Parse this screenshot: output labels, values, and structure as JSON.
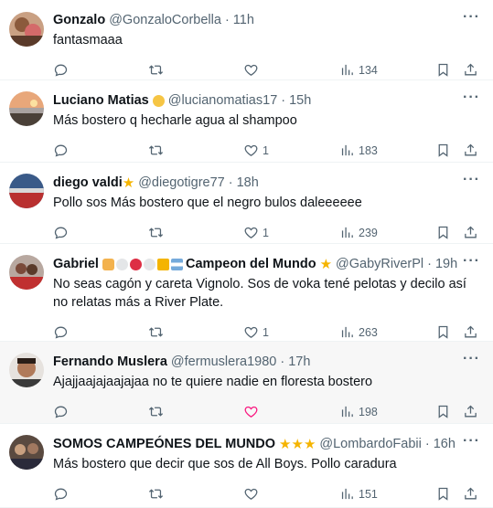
{
  "tweets": [
    {
      "name": "Gonzalo",
      "handle": "@GonzaloCorbella",
      "time": "11h",
      "text": "fantasmaaa",
      "likes": "",
      "views": "134"
    },
    {
      "name": "Luciano Matias",
      "handle": "@lucianomatias17",
      "time": "15h",
      "text": "Más bostero q hecharle agua al shampoo",
      "likes": "1",
      "views": "183"
    },
    {
      "name": "diego valdi",
      "handle": "@diegotigre77",
      "time": "18h",
      "text": "Pollo sos Más bostero  que el negro bulos daleeeeee",
      "likes": "1",
      "views": "239"
    },
    {
      "name": "Gabriel",
      "name_suffix": "Campeon del Mundo",
      "handle": "@GabyRiverPl",
      "time": "19h",
      "text": "No seas cagón y careta Vignolo. Sos de voka tené pelotas y decilo así no relatas más a River Plate.",
      "likes": "1",
      "views": "263"
    },
    {
      "name": "Fernando Muslera",
      "handle": "@fermuslera1980",
      "time": "17h",
      "text": "Ajajjaajajaajajaa no te quiere nadie en floresta bostero",
      "likes": "",
      "views": "198"
    },
    {
      "name": "SOMOS CAMPEÓNES DEL MUNDO",
      "handle": "@LombardoFabii",
      "time": "16h",
      "text": "Más bostero que decir que sos de All Boys. Pollo caradura",
      "likes": "",
      "views": "151"
    }
  ],
  "icons": {
    "reply": "reply-icon",
    "retweet": "retweet-icon",
    "like": "heart-icon",
    "views": "views-icon",
    "bookmark": "bookmark-icon",
    "share": "share-icon",
    "more": "more-icon"
  },
  "colors": {
    "text": "#0f1419",
    "muted": "#536471",
    "like_hover": "#f91880",
    "star": "#f5b400"
  }
}
